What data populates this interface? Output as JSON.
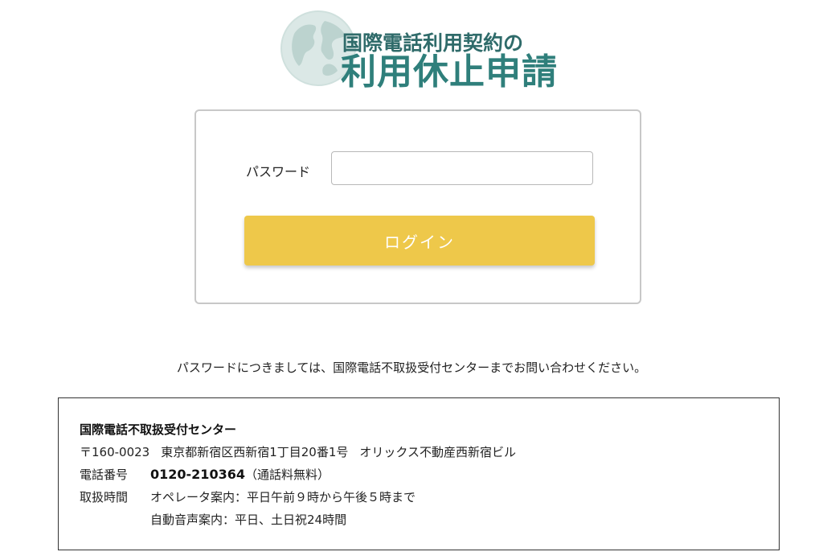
{
  "header": {
    "title_line1": "国際電話利用契約の",
    "title_line2": "利用休止申請",
    "brand_color": "#2f7f7b",
    "logo_icon": "globe-icon"
  },
  "login": {
    "password_label": "パスワード",
    "password_value": "",
    "password_placeholder": "",
    "login_button_label": "ログイン",
    "button_color": "#eec84a"
  },
  "notice": "パスワードにつきましては、国際電話不取扱受付センターまでお問い合わせください。",
  "contact": {
    "name": "国際電話不取扱受付センター",
    "postal": "〒160-0023",
    "address": "東京都新宿区西新宿1丁目20番1号",
    "building": "オリックス不動産西新宿ビル",
    "phone_label": "電話番号",
    "phone_number": "0120-210364",
    "phone_note": "（通話料無料）",
    "hours_label": "取扱時間",
    "hours_operator": "オペレータ案内：平日午前９時から午後５時まで",
    "hours_auto": "自動音声案内：平日、土日祝24時間"
  }
}
